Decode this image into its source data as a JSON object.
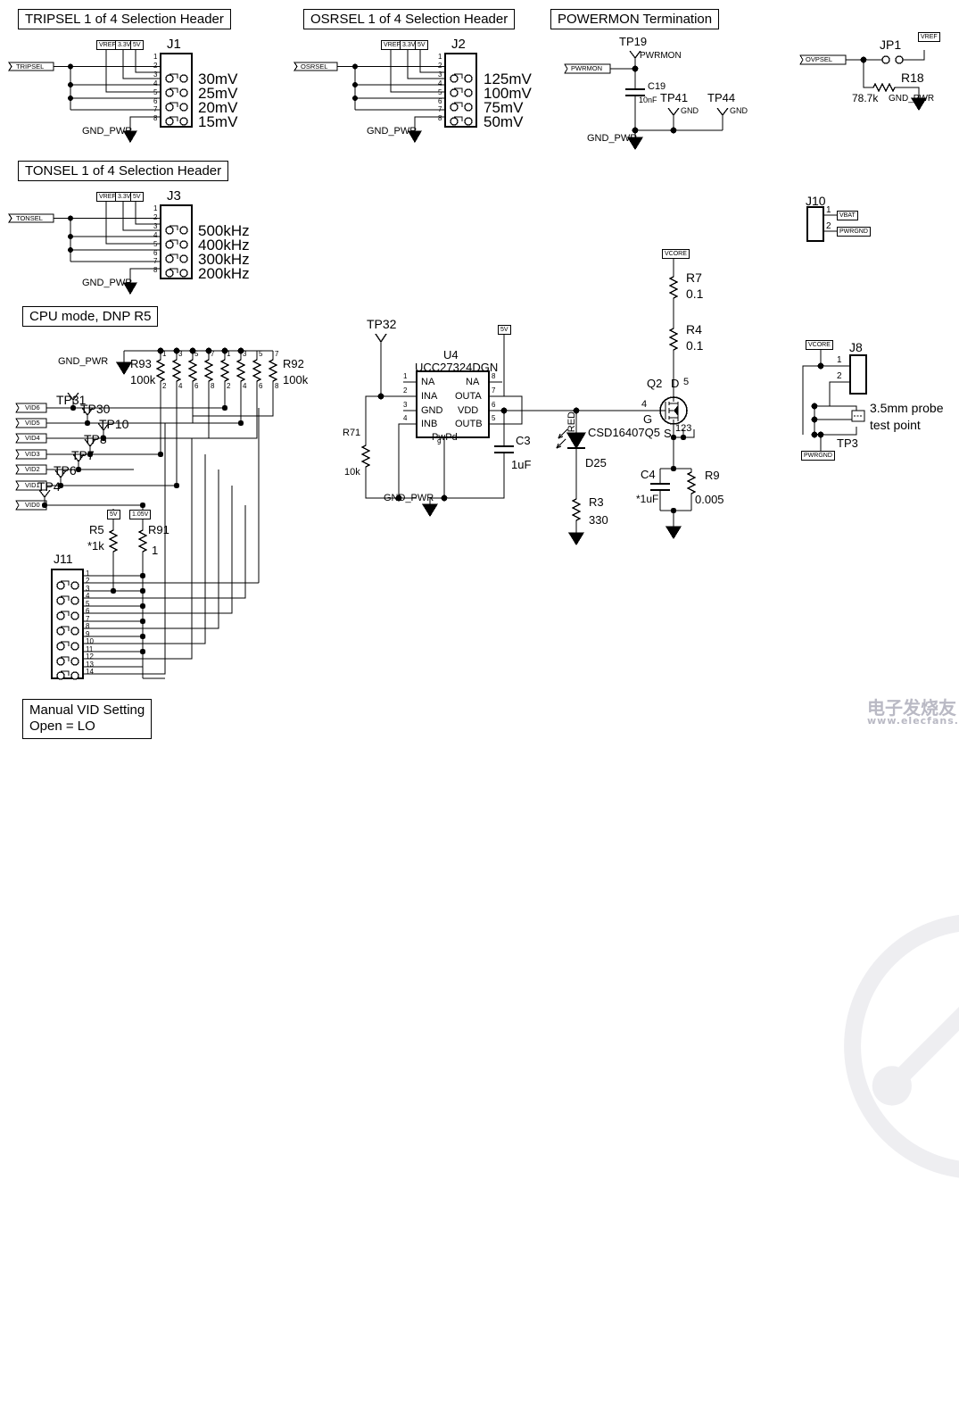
{
  "sheet": {
    "watermark": {
      "text_cn": "电子发烧友",
      "text_url": "www.elecfans.com"
    }
  },
  "blocks": [
    {
      "id": "tripsel",
      "title": "TRIPSEL 1 of 4 Selection Header"
    },
    {
      "id": "osrsel",
      "title": "OSRSEL 1 of 4 Selection Header"
    },
    {
      "id": "powermon",
      "title": "POWERMON Termination"
    },
    {
      "id": "tonsel",
      "title": "TONSEL 1 of 4 Selection Header"
    },
    {
      "id": "cpumode",
      "title": "CPU mode, DNP R5"
    },
    {
      "id": "manualvid",
      "title_line1": "Manual VID Setting",
      "title_line2": "Open = LO"
    }
  ],
  "tripsel": {
    "port": "TRIPSEL",
    "refdes": "J1",
    "flags": [
      "VREF",
      "3.3V",
      "5V"
    ],
    "gnd": "GND_PWR",
    "pins": [
      "1",
      "2",
      "3",
      "4",
      "5",
      "6",
      "7",
      "8"
    ],
    "options": [
      "30mV",
      "25mV",
      "20mV",
      "15mV"
    ]
  },
  "osrsel": {
    "port": "OSRSEL",
    "refdes": "J2",
    "flags": [
      "VREF",
      "3.3V",
      "5V"
    ],
    "gnd": "GND_PWR",
    "pins": [
      "1",
      "2",
      "3",
      "4",
      "5",
      "6",
      "7",
      "8"
    ],
    "options": [
      "125mV",
      "100mV",
      "75mV",
      "50mV"
    ]
  },
  "tonsel": {
    "port": "TONSEL",
    "refdes": "J3",
    "flags": [
      "VREF",
      "3.3V",
      "5V"
    ],
    "gnd": "GND_PWR",
    "pins": [
      "1",
      "2",
      "3",
      "4",
      "5",
      "6",
      "7",
      "8"
    ],
    "options": [
      "500kHz",
      "400kHz",
      "300kHz",
      "200kHz"
    ]
  },
  "powermon": {
    "port": "PWRMON",
    "net_label": "PWRMON",
    "testpoints": [
      {
        "name": "TP19",
        "net": ""
      },
      {
        "name": "TP41",
        "net": "GND"
      },
      {
        "name": "TP44",
        "net": "GND"
      }
    ],
    "cap": {
      "refdes": "C19",
      "value": "10nF"
    },
    "gnd": "GND_PWR"
  },
  "ovpsel": {
    "port": "OVPSEL",
    "jumper": "JP1",
    "flag": "VREF",
    "resistor": {
      "refdes": "R18",
      "value": "78.7k"
    },
    "gnd": "GND_PWR"
  },
  "j10": {
    "refdes": "J10",
    "pins": [
      "1",
      "2"
    ],
    "nets": [
      "VBAT",
      "PWRGND"
    ]
  },
  "j8": {
    "refdes": "J8",
    "pins": [
      "1",
      "2"
    ],
    "flag_top": "VCORE",
    "flag_bottom": "PWRGND",
    "testpoint": "TP3",
    "note_line1": "3.5mm probe",
    "note_line2": "test point"
  },
  "driver": {
    "refdes": "U4",
    "part": "UCC27324DGN",
    "testpoint": "TP32",
    "flag_5v": "5V",
    "pins_left": [
      {
        "num": "1",
        "name": "NA"
      },
      {
        "num": "2",
        "name": "INA"
      },
      {
        "num": "3",
        "name": "GND"
      },
      {
        "num": "4",
        "name": "INB"
      }
    ],
    "pins_right": [
      {
        "num": "8",
        "name": "NA"
      },
      {
        "num": "7",
        "name": "OUTA"
      },
      {
        "num": "6",
        "name": "VDD"
      },
      {
        "num": "5",
        "name": "OUTB"
      }
    ],
    "pad": {
      "num": "9",
      "name": "PwPd"
    },
    "r71": {
      "refdes": "R71",
      "value": "10k"
    },
    "c3": {
      "refdes": "C3",
      "value": "1uF"
    },
    "gnd": "GND_PWR"
  },
  "led": {
    "net": "RED",
    "diode": "D25",
    "resistor": {
      "refdes": "R3",
      "value": "330"
    }
  },
  "power_stage": {
    "flag_vcore": "VCORE",
    "r7": {
      "refdes": "R7",
      "value": "0.1"
    },
    "r4": {
      "refdes": "R4",
      "value": "0.1"
    },
    "fet": {
      "refdes": "Q2",
      "part": "CSD16407Q5",
      "drain_label": "D",
      "drain_pin": "5",
      "gate_label": "G",
      "gate_pin": "4",
      "source_label": "S",
      "source_pins": "123"
    },
    "c4": {
      "refdes": "C4",
      "value": "*1uF"
    },
    "r9": {
      "refdes": "R9",
      "value": "0.005"
    }
  },
  "cpu_mode": {
    "gnd": "GND_PWR",
    "r93": {
      "refdes": "R93",
      "value": "100k",
      "pins_top": [
        "1",
        "3",
        "5",
        "7"
      ],
      "pins_bot": [
        "2",
        "4",
        "6",
        "8"
      ]
    },
    "r92": {
      "refdes": "R92",
      "value": "100k",
      "pins_top": [
        "1",
        "3",
        "5",
        "7"
      ],
      "pins_bot": [
        "2",
        "4",
        "6",
        "8"
      ]
    },
    "vid_ports": [
      "VID6",
      "VID5",
      "VID4",
      "VID3",
      "VID2",
      "VID1",
      "VID0"
    ],
    "testpoints": [
      "TP31",
      "TP30",
      "TP10",
      "TP8",
      "TP7",
      "TP6",
      "TP4"
    ],
    "flags": [
      "5V",
      "1.05V"
    ],
    "r5": {
      "refdes": "R5",
      "value": "*1k"
    },
    "r91": {
      "refdes": "R91",
      "value": "1"
    },
    "j11": {
      "refdes": "J11",
      "pins": [
        "1",
        "2",
        "3",
        "4",
        "5",
        "6",
        "7",
        "8",
        "9",
        "10",
        "11",
        "12",
        "13",
        "14"
      ]
    }
  }
}
